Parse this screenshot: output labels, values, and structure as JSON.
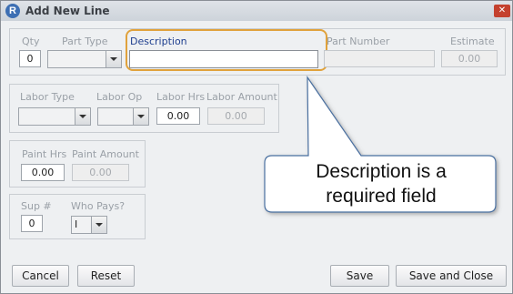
{
  "window": {
    "title": "Add New Line",
    "app_icon_letter": "R",
    "close_glyph": "✕"
  },
  "line": {
    "qty_label": "Qty",
    "qty_value": "0",
    "part_type_label": "Part Type",
    "part_type_value": "",
    "description_label": "Description",
    "description_value": "",
    "part_number_label": "Part Number",
    "part_number_value": "",
    "estimate_label": "Estimate",
    "estimate_value": "0.00"
  },
  "labor": {
    "type_label": "Labor Type",
    "type_value": "",
    "op_label": "Labor Op",
    "op_value": "",
    "hrs_label": "Labor Hrs",
    "hrs_value": "0.00",
    "amount_label": "Labor Amount",
    "amount_value": "0.00"
  },
  "paint": {
    "hrs_label": "Paint Hrs",
    "hrs_value": "0.00",
    "amount_label": "Paint Amount",
    "amount_value": "0.00"
  },
  "supplement": {
    "sup_label": "Sup #",
    "sup_value": "0",
    "who_pays_label": "Who Pays?",
    "who_pays_value": "I"
  },
  "buttons": {
    "cancel": "Cancel",
    "reset": "Reset",
    "save": "Save",
    "save_close": "Save and Close"
  },
  "callout": {
    "line1": "Description is a",
    "line2": "required field"
  },
  "colors": {
    "highlight": "#e0a23c",
    "label": "#1f3f8f",
    "callout_fill": "#ffffff"
  },
  "icons": [
    "app-logo-icon",
    "close-icon",
    "dropdown-arrow-icon"
  ]
}
